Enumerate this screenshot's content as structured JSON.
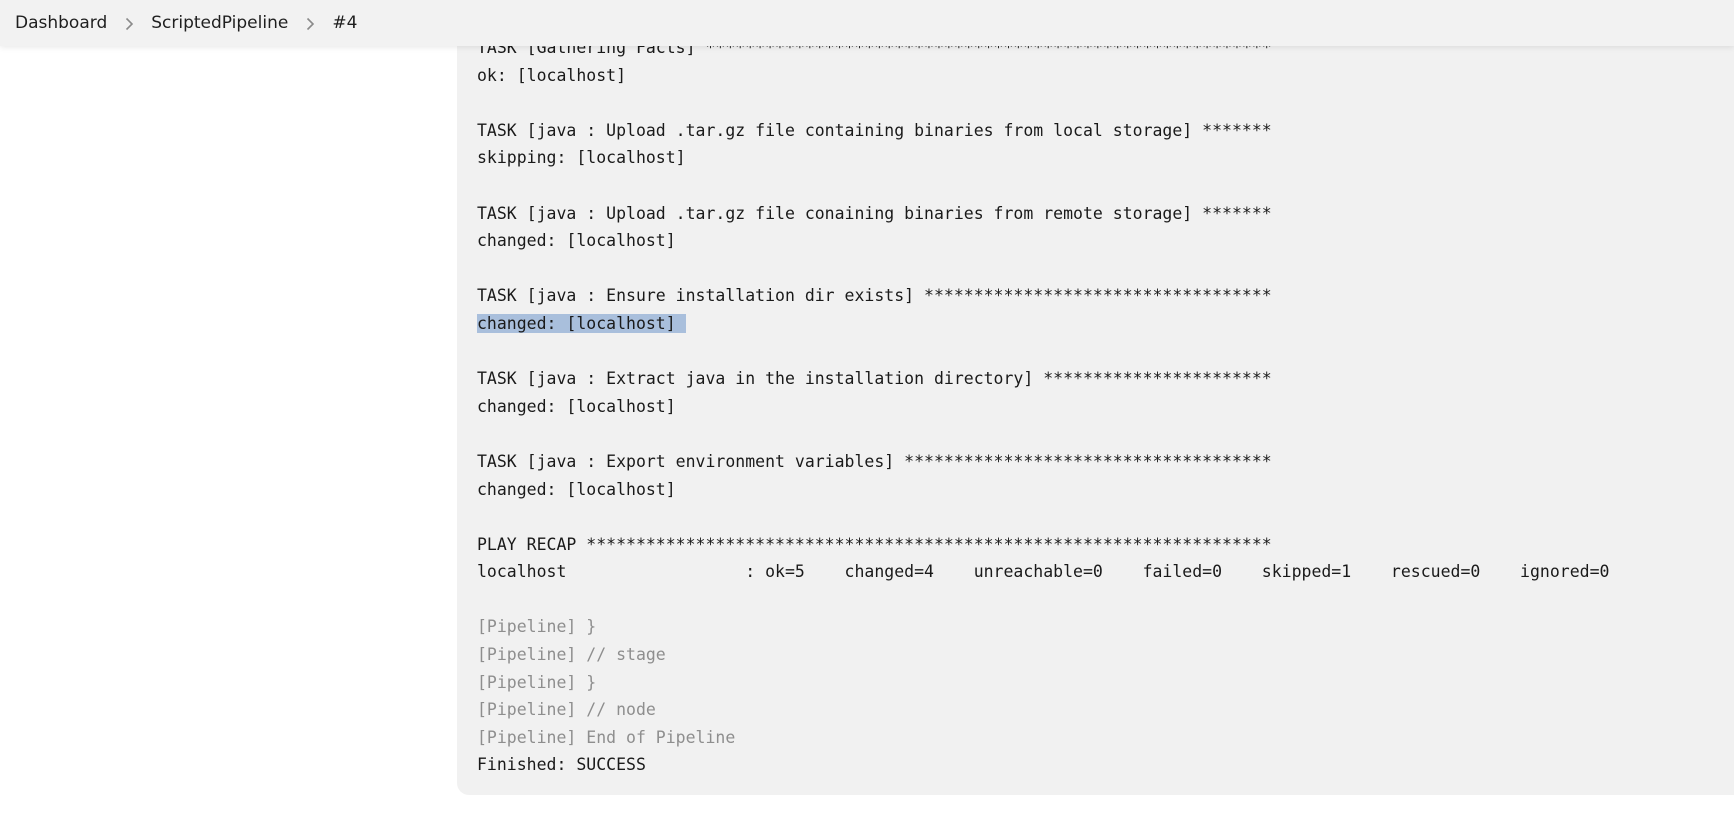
{
  "breadcrumb": {
    "items": [
      "Dashboard",
      "ScriptedPipeline",
      "#4"
    ]
  },
  "console": {
    "highlight_color": "#a9bfdc",
    "lines": [
      {
        "text": "TASK [Gathering Facts] *********************************************************",
        "style": "normal"
      },
      {
        "text": "ok: [localhost]",
        "style": "normal"
      },
      {
        "text": "",
        "style": "normal"
      },
      {
        "text": "TASK [java : Upload .tar.gz file containing binaries from local storage] *******",
        "style": "normal"
      },
      {
        "text": "skipping: [localhost]",
        "style": "normal"
      },
      {
        "text": "",
        "style": "normal"
      },
      {
        "text": "TASK [java : Upload .tar.gz file conaining binaries from remote storage] *******",
        "style": "normal"
      },
      {
        "text": "changed: [localhost]",
        "style": "normal"
      },
      {
        "text": "",
        "style": "normal"
      },
      {
        "text": "TASK [java : Ensure installation dir exists] ***********************************",
        "style": "normal"
      },
      {
        "text": "changed: [localhost]",
        "style": "highlight"
      },
      {
        "text": "",
        "style": "normal"
      },
      {
        "text": "TASK [java : Extract java in the installation directory] ***********************",
        "style": "normal"
      },
      {
        "text": "changed: [localhost]",
        "style": "normal"
      },
      {
        "text": "",
        "style": "normal"
      },
      {
        "text": "TASK [java : Export environment variables] *************************************",
        "style": "normal"
      },
      {
        "text": "changed: [localhost]",
        "style": "normal"
      },
      {
        "text": "",
        "style": "normal"
      },
      {
        "text": "PLAY RECAP *********************************************************************",
        "style": "normal"
      },
      {
        "text": "localhost                  : ok=5    changed=4    unreachable=0    failed=0    skipped=1    rescued=0    ignored=0",
        "style": "normal"
      },
      {
        "text": "",
        "style": "normal"
      },
      {
        "text": "[Pipeline] }",
        "style": "dim"
      },
      {
        "text": "[Pipeline] // stage",
        "style": "dim"
      },
      {
        "text": "[Pipeline] }",
        "style": "dim"
      },
      {
        "text": "[Pipeline] // node",
        "style": "dim"
      },
      {
        "text": "[Pipeline] End of Pipeline",
        "style": "dim"
      },
      {
        "text": "Finished: SUCCESS",
        "style": "normal"
      }
    ]
  }
}
